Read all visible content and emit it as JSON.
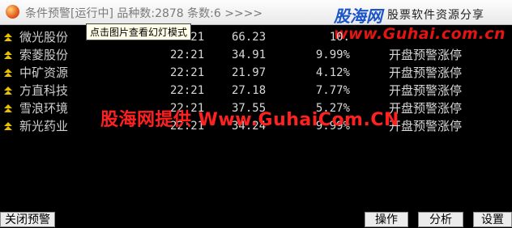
{
  "window": {
    "title": "条件预警[运行中] 品种数:2878 条数:6 >>>>"
  },
  "logo": {
    "name": "股海网",
    "slogan": "股票软件资源分享",
    "url": "www.Guhai.com.cn"
  },
  "tooltip": "点击图片查看幻灯模式",
  "rows": [
    {
      "name": "微光股份",
      "time": "22:21",
      "price": "66.23",
      "pct": "10.",
      "status": ""
    },
    {
      "name": "索菱股份",
      "time": "22:21",
      "price": "34.91",
      "pct": "9.99%",
      "status": "开盘预警涨停"
    },
    {
      "name": "中矿资源",
      "time": "22:21",
      "price": "21.97",
      "pct": "4.12%",
      "status": "开盘预警涨停"
    },
    {
      "name": "方直科技",
      "time": "22:21",
      "price": "27.18",
      "pct": "7.77%",
      "status": "开盘预警涨停"
    },
    {
      "name": "雪浪环境",
      "time": "22:21",
      "price": "37.55",
      "pct": "5.27%",
      "status": "开盘预警涨停"
    },
    {
      "name": "新光药业",
      "time": "22:21",
      "price": "34.24",
      "pct": "9.99%",
      "status": "开盘预警涨停"
    }
  ],
  "watermark": "股海网提供 Www.GuhaiCom.CN",
  "buttons": {
    "close": "关闭预警",
    "operate": "操作",
    "analyze": "分析",
    "settings": "设置"
  },
  "colors": {
    "background": "#000000",
    "watermark": "#ff2020",
    "logo_blue": "#1b55c8",
    "logo_red": "#e21414",
    "mark": "#e8c000"
  }
}
